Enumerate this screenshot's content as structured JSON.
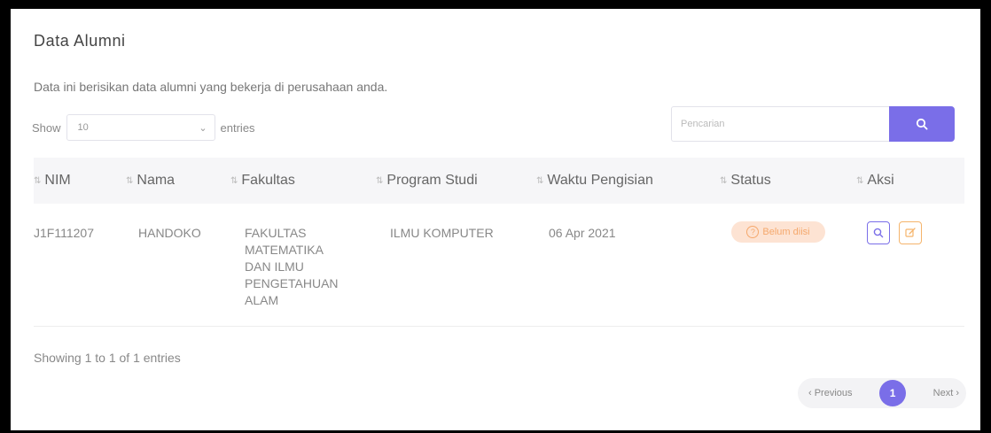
{
  "page": {
    "title": "Data Alumni",
    "description": "Data ini berisikan data alumni yang bekerja di perusahaan anda."
  },
  "controls": {
    "show_label": "Show",
    "entries_value": "10",
    "entries_label": "entries",
    "search_placeholder": "Pencarian"
  },
  "table": {
    "headers": [
      "NIM",
      "Nama",
      "Fakultas",
      "Program Studi",
      "Waktu Pengisian",
      "Status",
      "Aksi"
    ],
    "rows": [
      {
        "nim": "J1F111207",
        "nama": "HANDOKO",
        "fakultas": "FAKULTAS\nMATEMATIKA\nDAN ILMU\nPENGETAHUAN\nALAM",
        "program_studi": "ILMU KOMPUTER",
        "waktu_pengisian": "06 Apr 2021",
        "status": "Belum diisi"
      }
    ]
  },
  "footer": {
    "info": "Showing 1 to 1 of 1 entries",
    "previous": "‹ Previous",
    "page": "1",
    "next": "Next ›"
  },
  "colors": {
    "accent": "#7a6ee8",
    "status_badge_bg": "#fde3d3",
    "status_badge_text": "#f5a86c",
    "edit_border": "#f5b46b"
  },
  "icons": {
    "search": "search-icon",
    "view": "search-icon",
    "edit": "edit-icon",
    "status": "question-circle-icon",
    "sort": "sort-icon"
  }
}
